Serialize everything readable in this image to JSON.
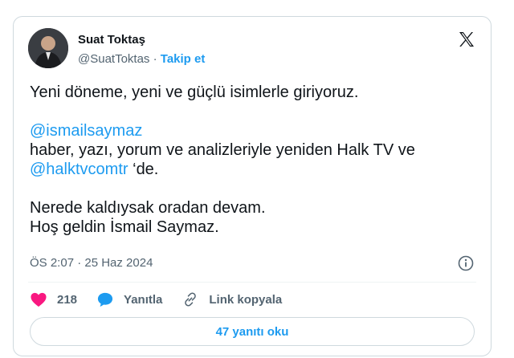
{
  "author": {
    "name": "Suat Toktaş",
    "handle": "@SuatToktas",
    "separator": "·",
    "follow_label": "Takip et"
  },
  "tweet": {
    "line1": "Yeni döneme, yeni ve güçlü isimlerle giriyoruz.",
    "mention1": "@ismailsaymaz",
    "line2": "haber, yazı, yorum ve analizleriyle yeniden Halk TV ve",
    "mention2": "@halktvcomtr",
    "line3_suffix": " ‘de.",
    "line4": "Nerede kaldıysak oradan devam.",
    "line5": "Hoş geldin İsmail Saymaz."
  },
  "meta": {
    "timestamp": "ÖS 2:07 · 25 Haz 2024"
  },
  "actions": {
    "like_count": "218",
    "reply_label": "Yanıtla",
    "copy_link_label": "Link kopyala"
  },
  "read_replies_label": "47 yanıtı oku",
  "icons": {
    "like": "heart-icon",
    "reply": "speech-bubble-icon",
    "copy": "link-icon",
    "info": "info-icon",
    "brand": "x-logo-icon"
  },
  "colors": {
    "accent": "#1d9bf0",
    "like": "#f91880",
    "muted": "#536471",
    "border": "#cfd9de"
  }
}
